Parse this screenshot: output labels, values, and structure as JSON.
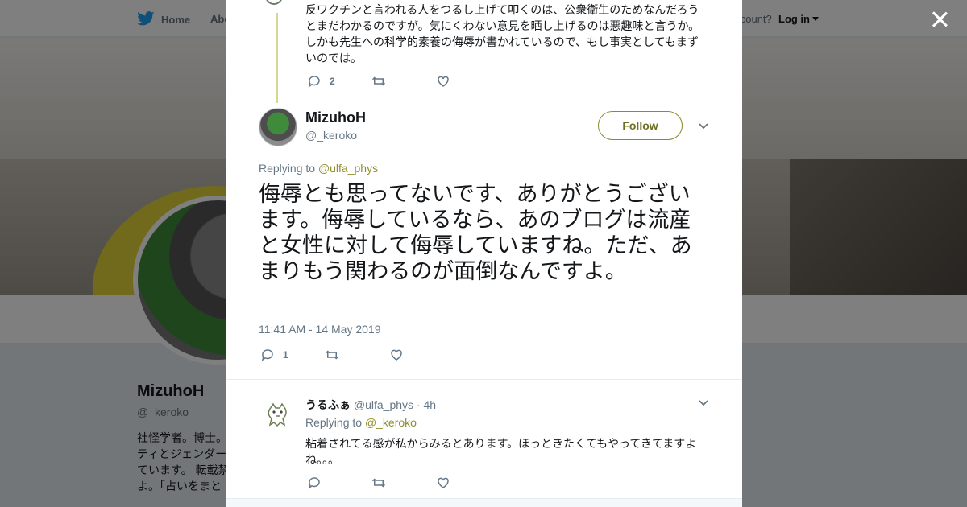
{
  "nav": {
    "home": "Home",
    "about": "Abo",
    "account_prompt": "account?",
    "login": "Log in"
  },
  "profile": {
    "name": "MizuhoH",
    "handle": "@_keroko",
    "bio": "社怪学者。博士。\nティとジェンダー\nています。 転載禁\nよ。「占いをまと"
  },
  "prev_tweet": {
    "text": "反ワクチンと言われる人をつるし上げて叩くのは、公衆衛生のためなんだろうとまだわかるのですが。気にくわない意見を晒し上げるのは悪趣味と言うか。しかも先生への科学的素養の侮辱が書かれているので、もし事実としてもまずいのでは。",
    "reply_count": "2"
  },
  "main_tweet": {
    "name": "MizuhoH",
    "handle": "@_keroko",
    "follow_label": "Follow",
    "replying_prefix": "Replying to",
    "replying_to": "@ulfa_phys",
    "text": "侮辱とも思ってないです、ありがとうございます。侮辱しているなら、あのブログは流産と女性に対して侮辱していますね。ただ、あまりもう関わるのが面倒なんですよ。",
    "timestamp": "11:41 AM - 14 May 2019",
    "reply_count": "1"
  },
  "reply_tweet": {
    "name": "うるふぁ",
    "handle": "@ulfa_phys",
    "time": "· 4h",
    "replying_prefix": "Replying to",
    "replying_to": "@_keroko",
    "text": "粘着されてる感が私からみるとあります。ほっときたくてもやってきてますよね。。。"
  },
  "colors": {
    "accent": "#8f8f2c",
    "twitter_blue": "#1da1f2",
    "text_secondary": "#657786"
  },
  "icons": [
    "twitter-bird-icon",
    "close-icon",
    "reply-icon",
    "retweet-icon",
    "like-icon",
    "chevron-down-icon"
  ]
}
